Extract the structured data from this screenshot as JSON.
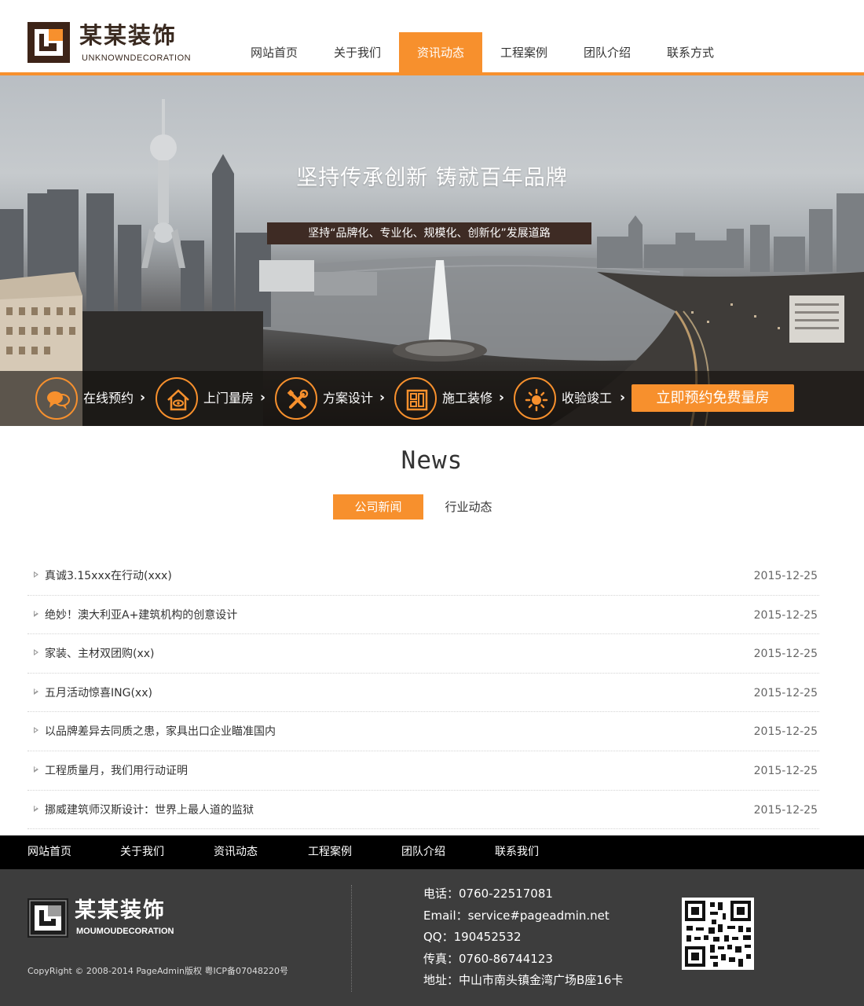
{
  "brand": {
    "name": "某某装饰",
    "subtitle": "UNKNOWNDECORATION",
    "accent_color": "#f7902d"
  },
  "nav": {
    "items": [
      {
        "label": "网站首页",
        "active": false
      },
      {
        "label": "关于我们",
        "active": false
      },
      {
        "label": "资讯动态",
        "active": true
      },
      {
        "label": "工程案例",
        "active": false
      },
      {
        "label": "团队介绍",
        "active": false
      },
      {
        "label": "联系方式",
        "active": false
      }
    ]
  },
  "banner": {
    "title": "坚持传承创新 铸就百年品牌",
    "subtitle": "坚持“品牌化、专业化、规模化、创新化”发展道路",
    "steps": [
      {
        "label": "在线预约",
        "icon": "chat-bubbles-icon"
      },
      {
        "label": "上门量房",
        "icon": "house-eye-icon"
      },
      {
        "label": "方案设计",
        "icon": "tools-icon"
      },
      {
        "label": "施工装修",
        "icon": "layout-icon"
      },
      {
        "label": "收验竣工",
        "icon": "sun-icon"
      }
    ],
    "cta_label": "立即预约免费量房"
  },
  "news": {
    "heading": "News",
    "tabs": [
      {
        "label": "公司新闻",
        "active": true
      },
      {
        "label": "行业动态",
        "active": false
      }
    ],
    "items": [
      {
        "title": "真诚3.15xxx在行动(xxx)",
        "date": "2015-12-25"
      },
      {
        "title": "绝妙！澳大利亚A+建筑机构的创意设计",
        "date": "2015-12-25"
      },
      {
        "title": "家装、主材双团购(xx)",
        "date": "2015-12-25"
      },
      {
        "title": "五月活动惊喜ING(xx)",
        "date": "2015-12-25"
      },
      {
        "title": "以品牌差异去同质之患，家具出口企业瞄准国内",
        "date": "2015-12-25"
      },
      {
        "title": "工程质量月，我们用行动证明",
        "date": "2015-12-25"
      },
      {
        "title": "挪威建筑师汉斯设计：世界上最人道的监狱",
        "date": "2015-12-25"
      }
    ]
  },
  "footer": {
    "nav": [
      "网站首页",
      "关于我们",
      "资讯动态",
      "工程案例",
      "团队介绍",
      "联系我们"
    ],
    "logo_name": "某某装饰",
    "logo_sub": "MOUMOUDECORATION",
    "copyright": "CopyRight © 2008-2014 PageAdmin版权 粤ICP备07048220号",
    "contact": {
      "phone": "电话：0760-22517081",
      "email": "Email：service#pageadmin.net",
      "qq": "QQ：190452532",
      "fax": "传真：0760-86744123",
      "address": "地址：中山市南头镇金湾广场B座16卡"
    },
    "qr_icon": "qr-code-icon"
  }
}
